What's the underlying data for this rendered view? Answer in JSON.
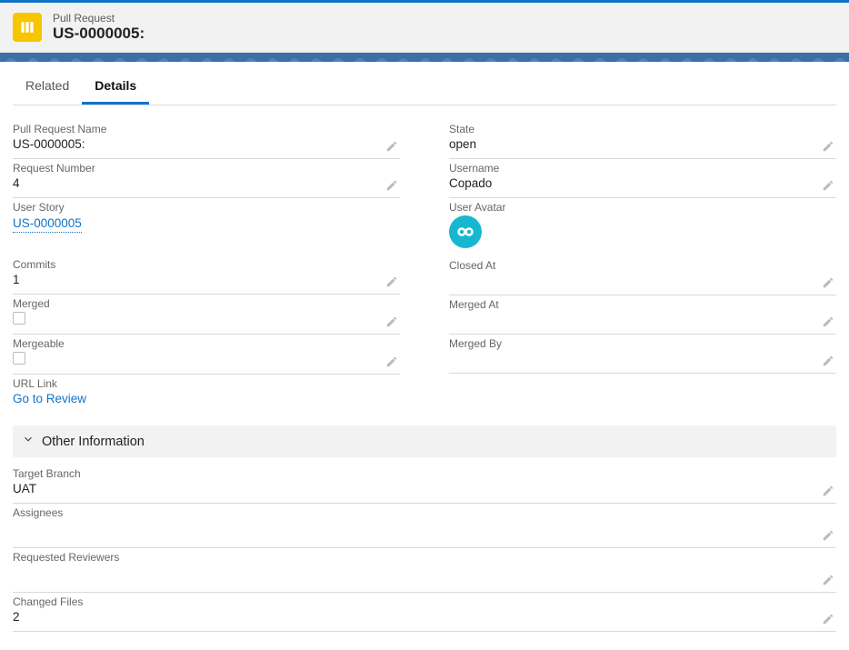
{
  "header": {
    "eyebrow": "Pull Request",
    "title": "US-0000005:"
  },
  "tabs": {
    "related": "Related",
    "details": "Details"
  },
  "left": {
    "pr_name": {
      "label": "Pull Request Name",
      "value": "US-0000005:"
    },
    "req_num": {
      "label": "Request Number",
      "value": "4"
    },
    "user_story": {
      "label": "User Story",
      "value": "US-0000005"
    },
    "commits": {
      "label": "Commits",
      "value": "1"
    },
    "merged": {
      "label": "Merged"
    },
    "mergeable": {
      "label": "Mergeable"
    },
    "url_link": {
      "label": "URL Link",
      "value": "Go to Review"
    }
  },
  "right": {
    "state": {
      "label": "State",
      "value": "open"
    },
    "username": {
      "label": "Username",
      "value": "Copado"
    },
    "user_avatar": {
      "label": "User Avatar"
    },
    "closed_at": {
      "label": "Closed At",
      "value": ""
    },
    "merged_at": {
      "label": "Merged At",
      "value": ""
    },
    "merged_by": {
      "label": "Merged By",
      "value": ""
    }
  },
  "section": {
    "title": "Other Information"
  },
  "bottom": {
    "target_branch": {
      "label": "Target Branch",
      "value": "UAT"
    },
    "assignees": {
      "label": "Assignees",
      "value": ""
    },
    "requested_reviewers": {
      "label": "Requested Reviewers",
      "value": ""
    },
    "changed_files": {
      "label": "Changed Files",
      "value": "2"
    }
  }
}
